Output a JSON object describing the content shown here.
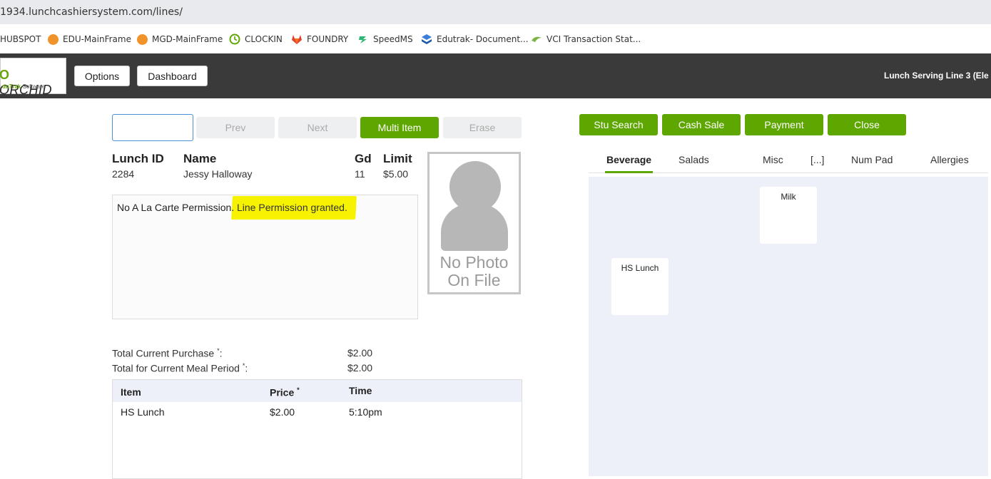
{
  "browser": {
    "url": "1934.lunchcashiersystem.com/lines/",
    "bookmarks": [
      {
        "label": "HUBSPOT",
        "icon": "hubspot-icon"
      },
      {
        "label": "EDU-MainFrame",
        "icon": "mainframe-icon"
      },
      {
        "label": "MGD-MainFrame",
        "icon": "mainframe-icon"
      },
      {
        "label": "CLOCKIN",
        "icon": "clock-icon"
      },
      {
        "label": "FOUNDRY",
        "icon": "gitlab-icon"
      },
      {
        "label": "SpeedMS",
        "icon": "speedms-icon"
      },
      {
        "label": "Edutrak- Document...",
        "icon": "edutrak-icon"
      },
      {
        "label": "VCI Transaction Stat...",
        "icon": "vci-icon"
      }
    ]
  },
  "header": {
    "logo_text": "ORCHID",
    "logo_sub_brand": "duTrak",
    "logo_sub_text": "Software",
    "options_label": "Options",
    "dashboard_label": "Dashboard",
    "title": "Lunch Serving Line 3 (Ele"
  },
  "student_nav": {
    "id_input_value": "",
    "prev_label": "Prev",
    "next_label": "Next",
    "multi_item_label": "Multi Item",
    "erase_label": "Erase"
  },
  "student": {
    "lunch_id_label": "Lunch ID",
    "name_label": "Name",
    "grade_label": "Gd",
    "limit_label": "Limit",
    "lunch_id": "2284",
    "name": "Jessy Halloway",
    "grade": "11",
    "limit": "$5.00",
    "message_plain": "No A La Carte Permission.",
    "message_highlight": "Line Permission granted.",
    "photo_text_line1": "No Photo",
    "photo_text_line2": "On File"
  },
  "totals": {
    "current_purchase_label": "Total Current Purchase",
    "current_purchase_value": "$2.00",
    "meal_period_label": "Total for Current Meal Period",
    "meal_period_value": "$2.00",
    "asterisk": "*",
    "colon": ":"
  },
  "purchases": {
    "headers": {
      "item": "Item",
      "price": "Price",
      "time": "Time"
    },
    "rows": [
      {
        "item": "HS Lunch",
        "price": "$2.00",
        "time": "5:10pm"
      }
    ]
  },
  "actions": {
    "stu_search_label": "Stu Search",
    "cash_sale_label": "Cash Sale",
    "payment_label": "Payment",
    "close_label": "Close"
  },
  "tabs": [
    {
      "label": "Beverage",
      "active": true
    },
    {
      "label": "Salads",
      "active": false
    },
    {
      "label": "Misc",
      "active": false
    },
    {
      "label": "[...]",
      "active": false
    },
    {
      "label": "Num Pad",
      "active": false
    },
    {
      "label": "Allergies",
      "active": false
    }
  ],
  "items": [
    {
      "label": "Milk"
    },
    {
      "label": "HS Lunch"
    }
  ],
  "colors": {
    "accent_green": "#5ea600",
    "header_bg": "#3a3a3a",
    "highlight_yellow": "#f6f200",
    "panel_bg": "#edf0f8"
  }
}
